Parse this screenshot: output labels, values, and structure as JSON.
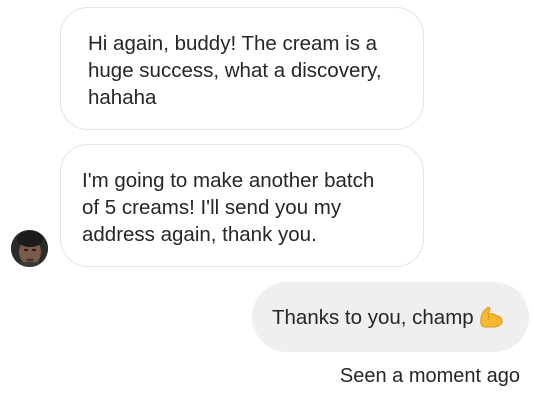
{
  "thread": {
    "messages": [
      {
        "from": "contact",
        "text": "Hi again, buddy! The cream is a\nhuge success, what a discovery,\nhahaha"
      },
      {
        "from": "contact",
        "text": "I'm going to make another batch\n of 5 creams! I'll send you my\naddress again, thank you."
      },
      {
        "from": "me",
        "text": "Thanks to you, champ",
        "emoji": "flexed-biceps-icon"
      }
    ],
    "seen_status": "Seen a moment ago"
  },
  "colors": {
    "incoming_bubble_bg": "#ffffff",
    "incoming_bubble_border": "#e3e3e3",
    "outgoing_bubble_bg": "#efefef",
    "text": "#262626",
    "emoji": "#f5b82e"
  }
}
